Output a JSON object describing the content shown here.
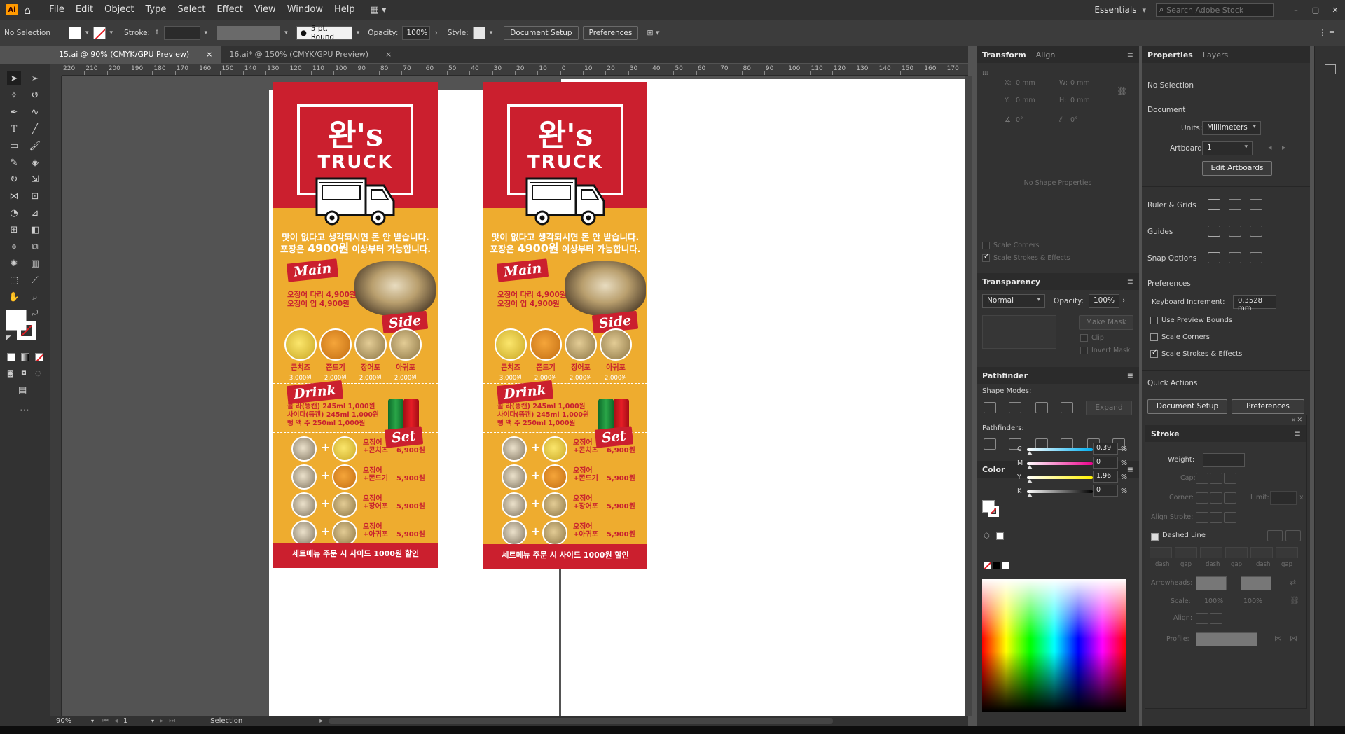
{
  "app": {
    "logo": "Ai"
  },
  "menu": {
    "items": [
      "File",
      "Edit",
      "Object",
      "Type",
      "Select",
      "Effect",
      "View",
      "Window",
      "Help"
    ]
  },
  "workspace": {
    "name": "Essentials",
    "search_placeholder": "Search Adobe Stock"
  },
  "control": {
    "selection": "No Selection",
    "stroke_label": "Stroke:",
    "brush": "5 pt. Round",
    "opacity_label": "Opacity:",
    "opacity_value": "100%",
    "style_label": "Style:",
    "doc_setup": "Document Setup",
    "preferences": "Preferences"
  },
  "tabs": [
    {
      "label": "15.ai @ 90% (CMYK/GPU Preview)",
      "close": "×"
    },
    {
      "label": "16.ai* @ 150% (CMYK/GPU Preview)",
      "close": "×"
    }
  ],
  "ruler": {
    "labels": [
      "220",
      "210",
      "200",
      "190",
      "180",
      "170",
      "160",
      "150",
      "140",
      "130",
      "120",
      "110",
      "100",
      "90",
      "80",
      "70",
      "60",
      "50",
      "40",
      "30",
      "20",
      "10",
      "0",
      "10",
      "20",
      "30",
      "40",
      "50",
      "60",
      "70",
      "80",
      "90",
      "100",
      "110",
      "120",
      "130",
      "140",
      "150",
      "160",
      "170"
    ]
  },
  "flyer": {
    "logo_top": "완's",
    "logo_bottom": "TRUCK",
    "tagline1": "맛이 없다고 생각되시면 돈 안 받습니다.",
    "tagline2_pre": "포장은 ",
    "tagline2_price": "4900원",
    "tagline2_post": " 이상부터 가능합니다.",
    "main_tag": "Main",
    "main_items": [
      "오징어 다리 4,900원",
      "오징어     입 4,900원"
    ],
    "side_tag": "Side",
    "side_items": [
      {
        "name": "콘치즈",
        "price": "3,000원"
      },
      {
        "name": "쫀드기",
        "price": "2,000원"
      },
      {
        "name": "장어포",
        "price": "2,000원"
      },
      {
        "name": "아귀포",
        "price": "2,000원"
      }
    ],
    "drink_tag": "Drink",
    "drink_items": [
      "콜     라(뚱캔) 245ml 1,000원",
      "사이다(뚱캔) 245ml 1,000원",
      "뻥     액     주 250ml 1,000원"
    ],
    "set_tag": "Set",
    "set_items": [
      {
        "line1": "오징어",
        "line2": "+콘치즈",
        "price": "6,900원"
      },
      {
        "line1": "오징어",
        "line2": "+쫀드기",
        "price": "5,900원"
      },
      {
        "line1": "오징어",
        "line2": "+장어포",
        "price": "5,900원"
      },
      {
        "line1": "오징어",
        "line2": "+아귀포",
        "price": "5,900원"
      }
    ],
    "plus": "+",
    "footer": "세트메뉴 주문 시 사이드 1000원 할인"
  },
  "panels": {
    "transform": {
      "tab1": "Transform",
      "tab2": "Align",
      "x": "X:",
      "y": "Y:",
      "w": "W:",
      "h": "H:",
      "empty": "No Shape Properties",
      "scale_corners": "Scale Corners",
      "scale_strokes": "Scale Strokes & Effects",
      "x_val": "0 mm",
      "w_val": "0 mm",
      "y_val": "0 mm",
      "h_val": "0 mm",
      "angle_val": "0°",
      "shear_val": "0°"
    },
    "transparency": {
      "title": "Transparency",
      "mode": "Normal",
      "opacity_label": "Opacity:",
      "opacity": "100%",
      "make_mask": "Make Mask",
      "clip": "Clip",
      "invert": "Invert Mask"
    },
    "pathfinder": {
      "title": "Pathfinder",
      "shape_modes": "Shape Modes:",
      "expand": "Expand",
      "pathfinders": "Pathfinders:"
    },
    "color": {
      "title": "Color",
      "channels": [
        {
          "label": "C",
          "value": "0.39",
          "color": "#00aeef"
        },
        {
          "label": "M",
          "value": "0",
          "color": "#ec008c"
        },
        {
          "label": "Y",
          "value": "1.96",
          "color": "#fff200"
        },
        {
          "label": "K",
          "value": "0",
          "color": "#000000"
        }
      ],
      "pct": "%"
    },
    "properties": {
      "tab1": "Properties",
      "tab2": "Layers",
      "selection": "No Selection",
      "document": "Document",
      "units_label": "Units:",
      "units": "Millimeters",
      "artboard_label": "Artboard:",
      "artboard": "1",
      "edit_artboards": "Edit Artboards",
      "ruler_grids": "Ruler & Grids",
      "guides": "Guides",
      "snap": "Snap Options",
      "prefs": "Preferences",
      "kb_label": "Keyboard Increment:",
      "kb_value": "0.3528 mm",
      "preview_bounds": "Use Preview Bounds",
      "scale_corners": "Scale Corners",
      "scale_strokes": "Scale Strokes & Effects",
      "quick_actions": "Quick Actions",
      "doc_setup": "Document Setup",
      "preferences": "Preferences"
    },
    "stroke": {
      "title": "Stroke",
      "weight": "Weight:",
      "cap": "Cap:",
      "corner": "Corner:",
      "limit": "Limit:",
      "align": "Align Stroke:",
      "dashed": "Dashed Line",
      "dash_labels": [
        "dash",
        "gap",
        "dash",
        "gap",
        "dash",
        "gap"
      ],
      "arrowheads": "Arrowheads:",
      "scale": "Scale:",
      "align2": "Align:",
      "profile": "Profile:",
      "scale_val1": "100%",
      "scale_val2": "100%",
      "limit_x": "x"
    }
  },
  "status": {
    "zoom": "90%",
    "artboard": "1",
    "tool": "Selection"
  }
}
